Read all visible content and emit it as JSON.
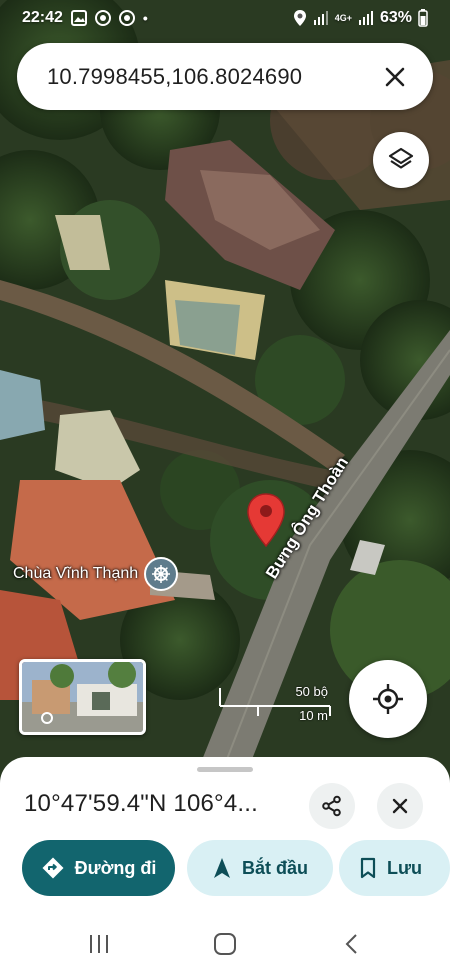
{
  "status_bar": {
    "time": "22:42",
    "dot": "•",
    "network": "4G+",
    "battery": "63%"
  },
  "search": {
    "query": "10.7998455,106.8024690"
  },
  "map": {
    "place_label": "Chùa Vĩnh Thạnh",
    "road_label": "Bưng Ông Thoàn",
    "scale_top": "50 bộ",
    "scale_bottom": "10 m"
  },
  "sheet": {
    "coordinates": "10°47'59.4\"N 106°4...",
    "directions_label": "Đường đi",
    "start_label": "Bắt đầu",
    "save_label": "Lưu"
  },
  "colors": {
    "primary": "#12656e",
    "chip_bg": "#d9f0f4",
    "pin_red": "#e53935"
  },
  "icons": [
    "gallery-icon",
    "chrome-icon",
    "location-icon",
    "signal-icon",
    "battery-icon",
    "close-icon",
    "layers-icon",
    "my-location-icon",
    "temple-icon",
    "map-pin-icon",
    "share-icon",
    "directions-icon",
    "navigation-icon",
    "bookmark-icon",
    "recents-icon",
    "home-icon",
    "back-icon"
  ]
}
